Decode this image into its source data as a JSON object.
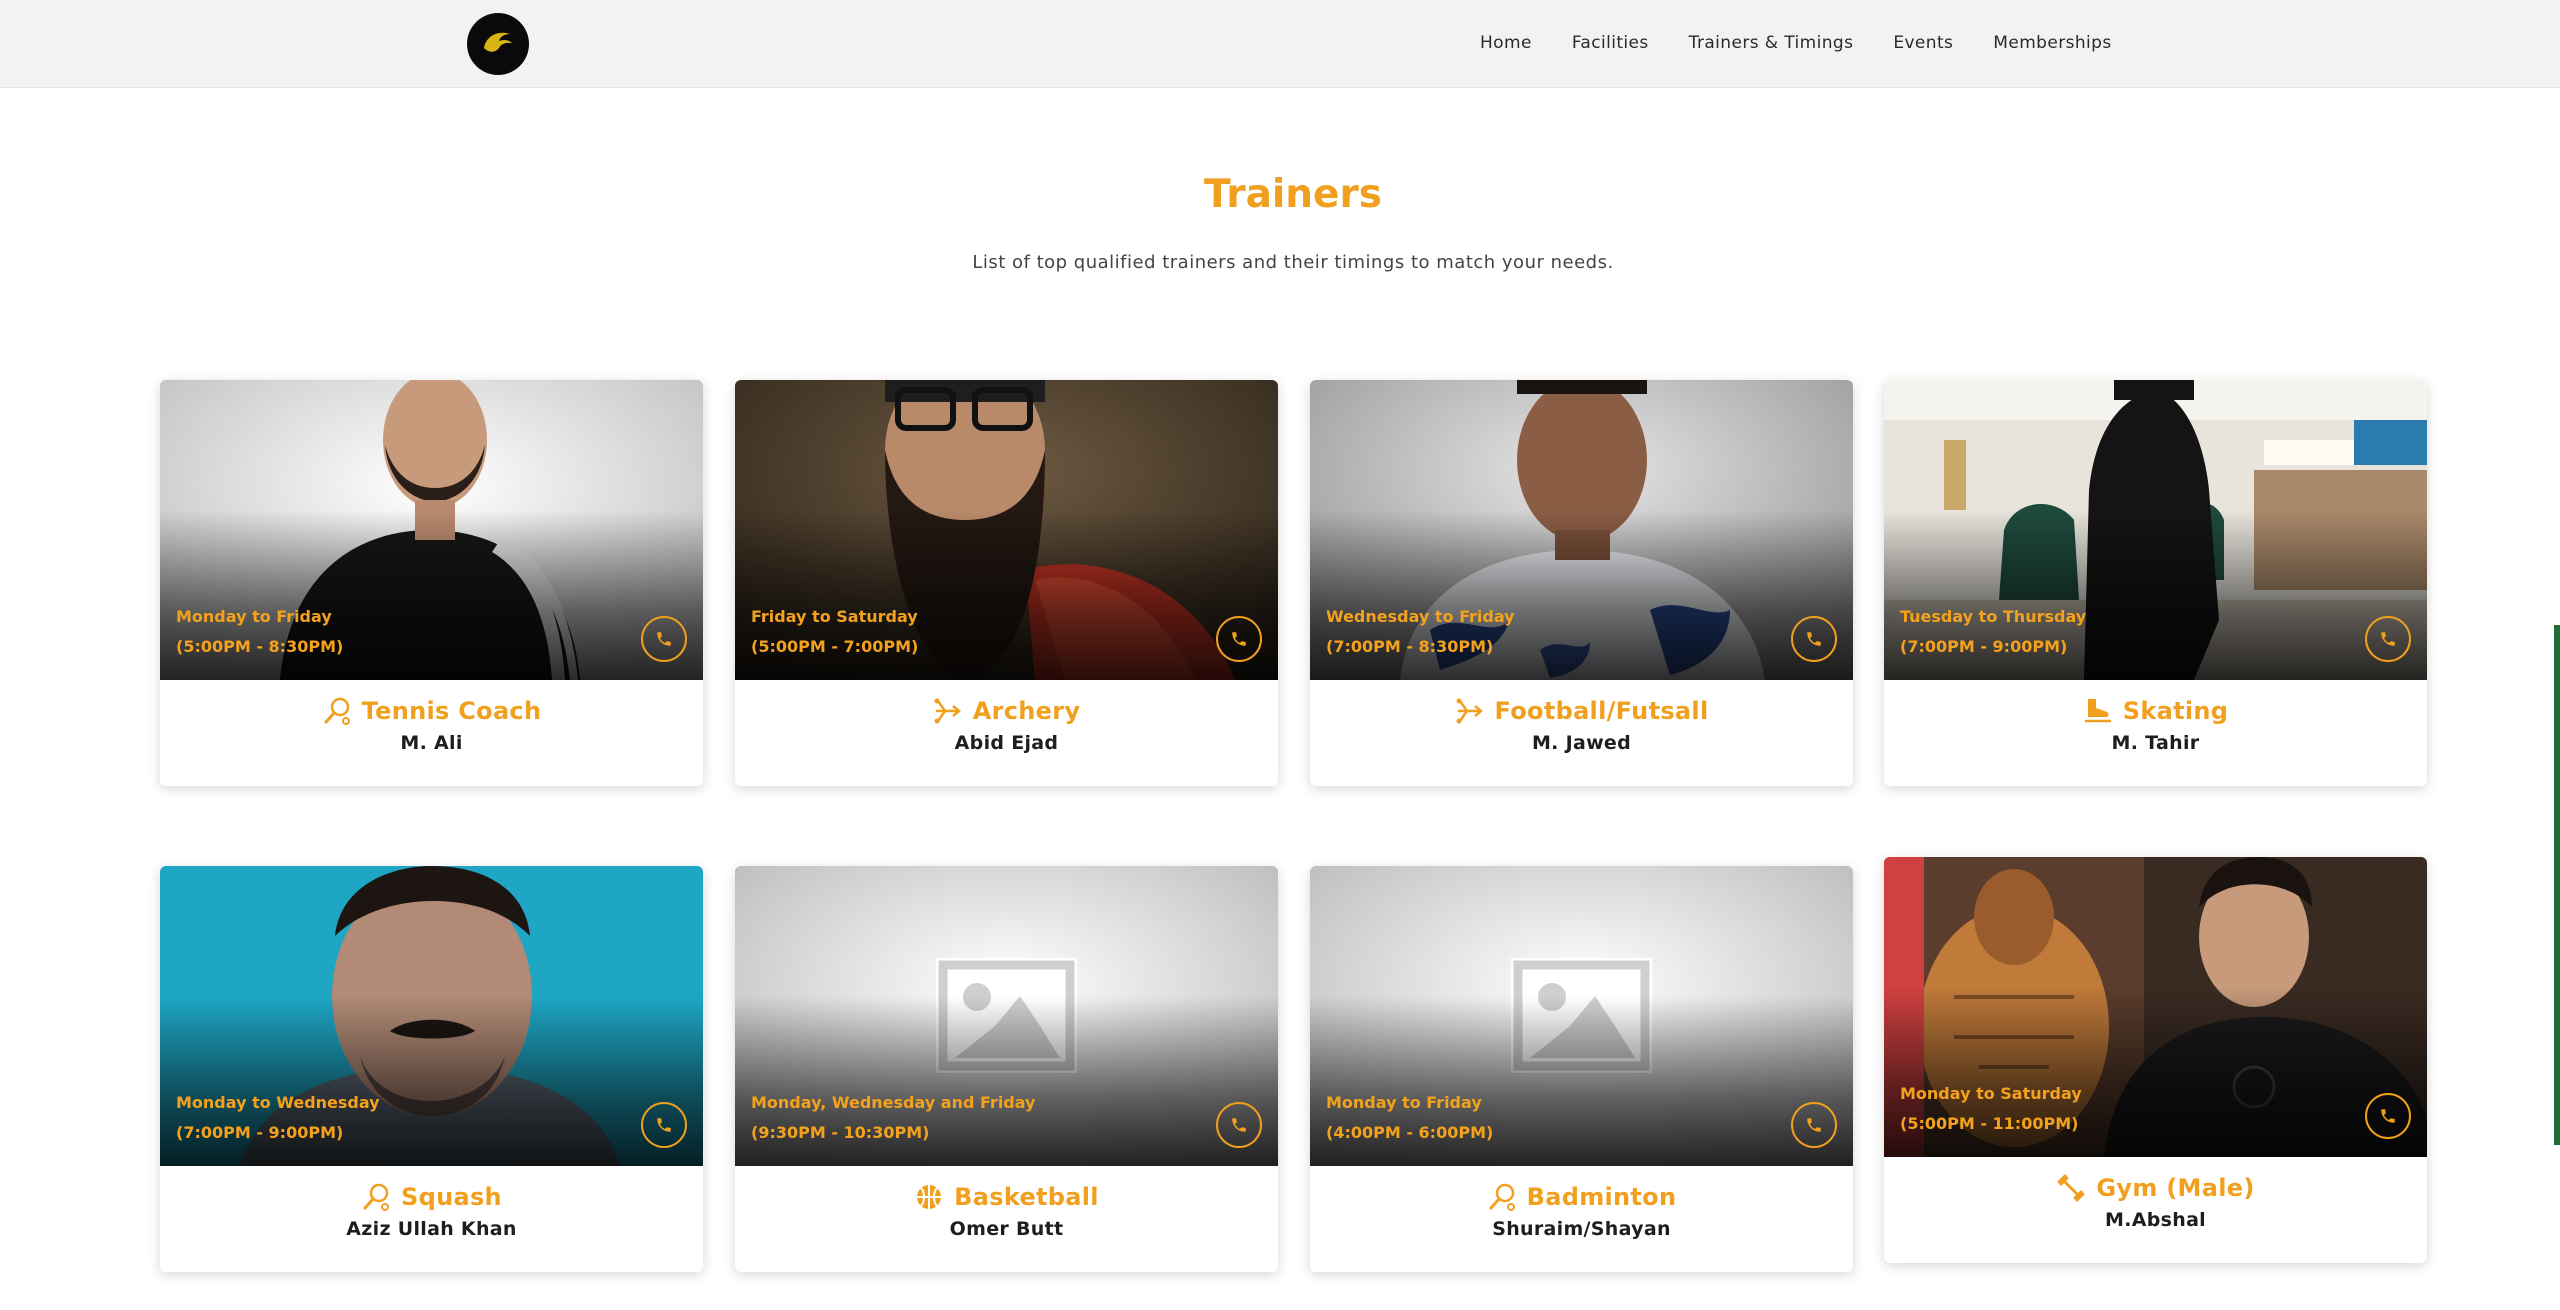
{
  "nav": {
    "logo_icon": "eagle-logo-icon",
    "links": [
      "Home",
      "Facilities",
      "Trainers & Timings",
      "Events",
      "Memberships"
    ]
  },
  "section": {
    "title": "Trainers",
    "subtitle": "List of top qualified trainers and their timings to match your needs."
  },
  "colors": {
    "accent": "#f0a01e",
    "nav_bg": "#f1f2f1"
  },
  "trainers": [
    {
      "days": "Monday to Friday",
      "time": "(5:00PM - 8:30PM)",
      "sport": "Tennis Coach",
      "sport_icon": "racket-icon",
      "name": "M. Ali"
    },
    {
      "days": "Friday to Saturday",
      "time": "(5:00PM - 7:00PM)",
      "sport": "Archery",
      "sport_icon": "archery-icon",
      "name": "Abid Ejad"
    },
    {
      "days": "Wednesday to Friday",
      "time": "(7:00PM - 8:30PM)",
      "sport": "Football/Futsall",
      "sport_icon": "football-icon",
      "name": "M. Jawed"
    },
    {
      "days": "Tuesday to Thursday",
      "time": "(7:00PM - 9:00PM)",
      "sport": "Skating",
      "sport_icon": "skate-icon",
      "name": "M. Tahir"
    },
    {
      "days": "Monday to Wednesday",
      "time": "(7:00PM - 9:00PM)",
      "sport": "Squash",
      "sport_icon": "racket-icon",
      "name": "Aziz Ullah Khan"
    },
    {
      "days": "Monday, Wednesday and Friday",
      "time": "(9:30PM - 10:30PM)",
      "sport": "Basketball",
      "sport_icon": "basketball-icon",
      "name": "Omer Butt"
    },
    {
      "days": "Monday to Friday",
      "time": "(4:00PM - 6:00PM)",
      "sport": "Badminton",
      "sport_icon": "racket-icon",
      "name": "Shuraim/Shayan"
    },
    {
      "days": "Monday to Saturday",
      "time": "(5:00PM - 11:00PM)",
      "sport": "Gym (Male)",
      "sport_icon": "dumbbell-icon",
      "name": "M.Abshal"
    }
  ]
}
